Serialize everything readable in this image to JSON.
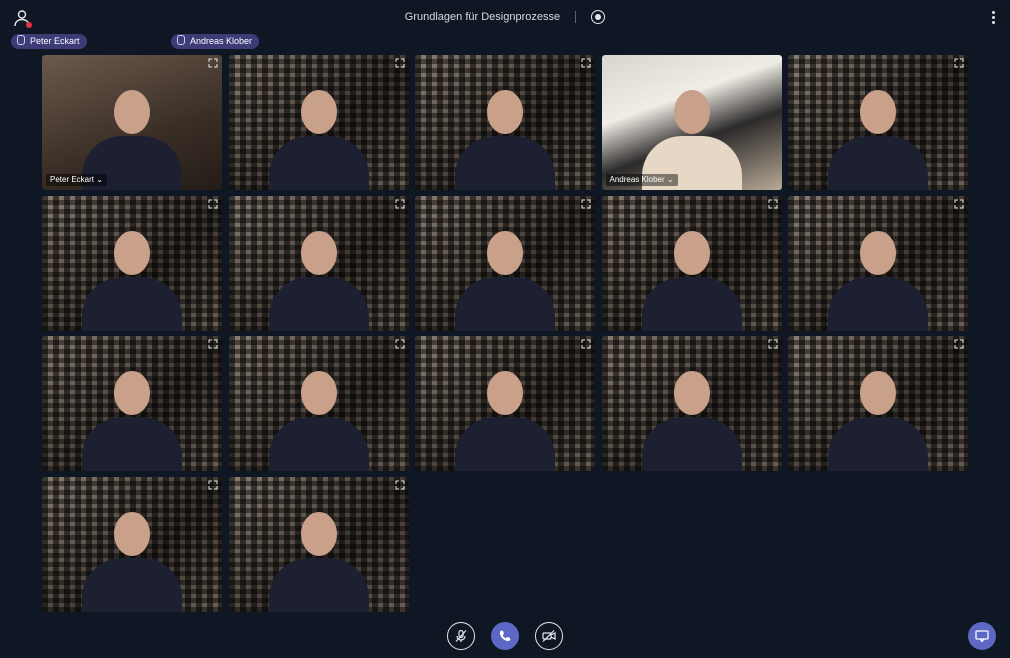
{
  "header": {
    "title": "Grundlagen für Designprozesse"
  },
  "speakers": [
    {
      "name": "Peter Eckart"
    },
    {
      "name": "Andreas Klober"
    }
  ],
  "tiles": [
    {
      "label": "Peter Eckart ⌄",
      "kind": "real"
    },
    {
      "label": "",
      "kind": "blur"
    },
    {
      "label": "",
      "kind": "blur"
    },
    {
      "label": "Andreas Klober ⌄",
      "kind": "real2"
    },
    {
      "label": "",
      "kind": "blur"
    },
    {
      "label": "",
      "kind": "blur"
    },
    {
      "label": "",
      "kind": "blur"
    },
    {
      "label": "",
      "kind": "blur"
    },
    {
      "label": "",
      "kind": "blur"
    },
    {
      "label": "",
      "kind": "blur"
    },
    {
      "label": "",
      "kind": "blur"
    },
    {
      "label": "",
      "kind": "blur"
    },
    {
      "label": "",
      "kind": "blur"
    },
    {
      "label": "",
      "kind": "blur"
    },
    {
      "label": "",
      "kind": "blur"
    },
    {
      "label": "",
      "kind": "blur"
    },
    {
      "label": "",
      "kind": "blur"
    }
  ],
  "colors": {
    "background": "#0f1724",
    "accent": "#5c68c4",
    "chip": "#3e3c77",
    "status_dot": "#e0334a"
  },
  "icons": {
    "user": "user-icon",
    "record": "record-icon",
    "menu": "kebab-menu-icon",
    "expand": "expand-icon",
    "mic_off": "mic-off-icon",
    "hangup": "phone-icon",
    "cam_off": "camera-off-icon",
    "chat": "chat-icon"
  }
}
